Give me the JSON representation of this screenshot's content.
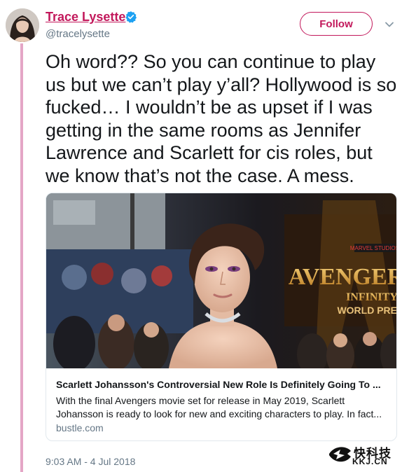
{
  "tweet": {
    "author": {
      "display_name": "Trace Lysette",
      "handle": "@tracelysette",
      "verified_icon": "verified-badge-icon",
      "avatar": "avatar-photo"
    },
    "follow_label": "Follow",
    "more_icon": "chevron-down-icon",
    "text": "Oh word?? So you can continue to play us but we can’t play y’all? Hollywood is so fucked… I wouldn’t be as upset if I was getting in the same rooms as Jennifer Lawrence and Scarlett for cis roles, but we know that’s not the case. A mess.",
    "timestamp": "9:03 AM - 4 Jul 2018"
  },
  "link_card": {
    "image": "red-carpet-photo",
    "image_text": {
      "brand": "MARVEL STUDIOS",
      "title": "AVENGERS",
      "subtitle": "INFINITY",
      "premiere": "WORLD PREMI"
    },
    "title": "Scarlett Johansson's Controversial New Role Is Definitely Going To ...",
    "description_lines": [
      "With the final Avengers movie set for release in May 2019, Scarlett",
      "Johansson is ready to look for new and exciting characters to play. In fact..."
    ],
    "domain": "bustle.com"
  },
  "watermark": {
    "text_top": "快科技",
    "text_bottom": "KKJ.CN"
  },
  "colors": {
    "accent": "#c2185b",
    "thread_line": "#e4a6c6",
    "verified": "#1da1f2",
    "secondary_text": "#657786",
    "border": "#e1e8ed"
  }
}
